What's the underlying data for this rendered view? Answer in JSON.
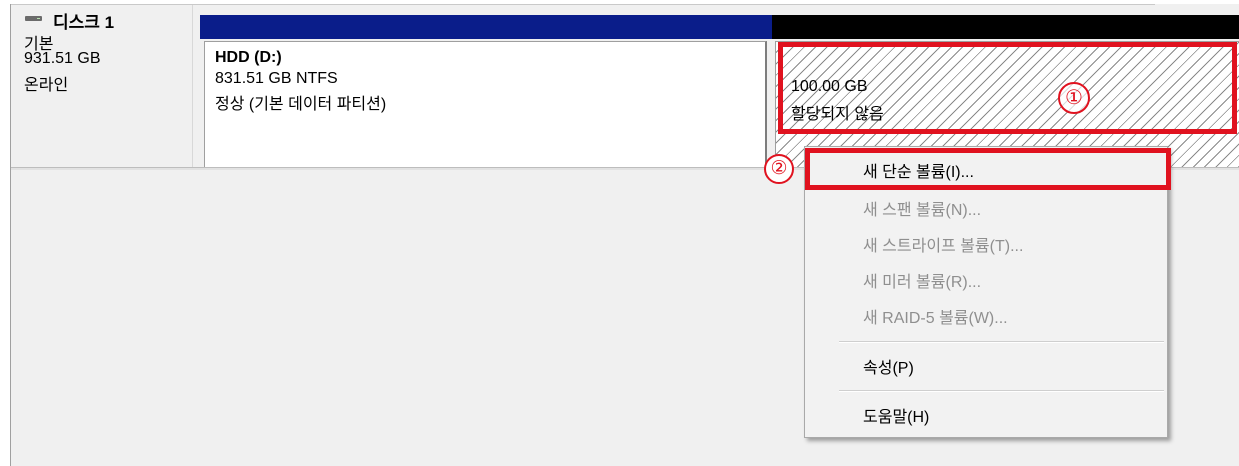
{
  "disk": {
    "name": "디스크 1",
    "type": "기본",
    "size": "931.51 GB",
    "status": "온라인",
    "icon": "drive-icon"
  },
  "partitions": {
    "hdd": {
      "title": "HDD  (D:)",
      "filesystem": "831.51 GB NTFS",
      "state": "정상 (기본 데이터 파티션)",
      "bar_color": "#0a1d8a"
    },
    "unallocated": {
      "size": "100.00 GB",
      "state": "할당되지 않음",
      "bar_color": "#000000"
    }
  },
  "annotations": {
    "marker_1": "①",
    "marker_2": "②",
    "highlight_color": "#e0121f"
  },
  "context_menu": {
    "items": [
      {
        "label": "새 단순 볼륨(I)...",
        "enabled": true
      },
      {
        "label": "새 스팬 볼륨(N)...",
        "enabled": false
      },
      {
        "label": "새 스트라이프 볼륨(T)...",
        "enabled": false
      },
      {
        "label": "새 미러 볼륨(R)...",
        "enabled": false
      },
      {
        "label": "새 RAID-5 볼륨(W)...",
        "enabled": false
      },
      {
        "label": "속성(P)",
        "enabled": true
      },
      {
        "label": "도움말(H)",
        "enabled": true
      }
    ]
  }
}
